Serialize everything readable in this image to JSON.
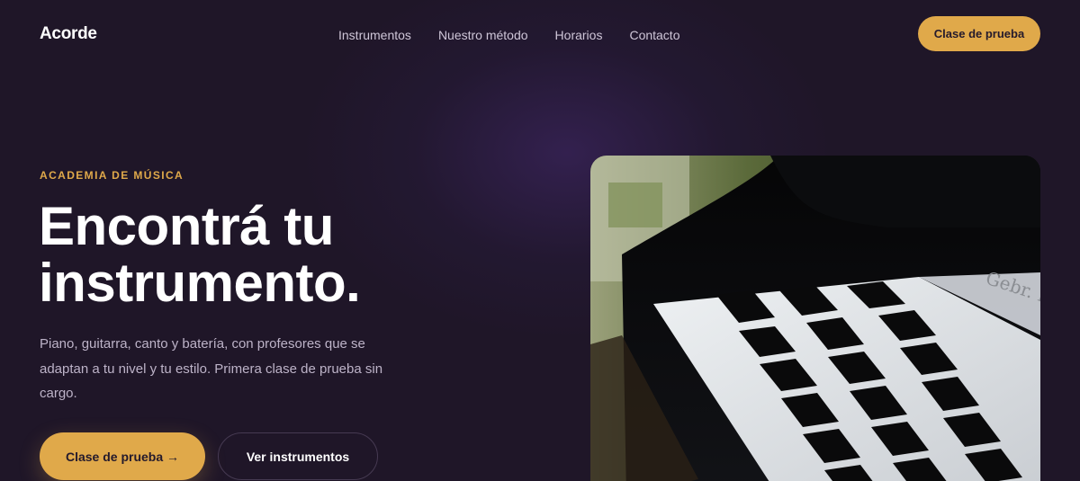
{
  "brand": {
    "name": "Acorde"
  },
  "nav": {
    "items": [
      {
        "label": "Instrumentos"
      },
      {
        "label": "Nuestro método"
      },
      {
        "label": "Horarios"
      },
      {
        "label": "Contacto"
      }
    ]
  },
  "header": {
    "cta_label": "Clase de prueba"
  },
  "hero": {
    "eyebrow": "ACADEMIA DE MÚSICA",
    "title_line1": "Encontrá tu",
    "title_line2": "instrumento.",
    "lead": "Piano, guitarra, canto y batería, con profesores que se adaptan a tu nivel y tu estilo. Primera clase de prueba sin cargo.",
    "primary_cta": "Clase de prueba →",
    "secondary_cta": "Ver instrumentos",
    "image": {
      "subject": "piano-keys-photo",
      "piano_brand_text": "Gebr. Nen"
    }
  },
  "colors": {
    "background": "#1f1628",
    "accent": "#e0a94a",
    "text_muted": "#bdb3c8",
    "nav_text": "#cfc6d8"
  }
}
